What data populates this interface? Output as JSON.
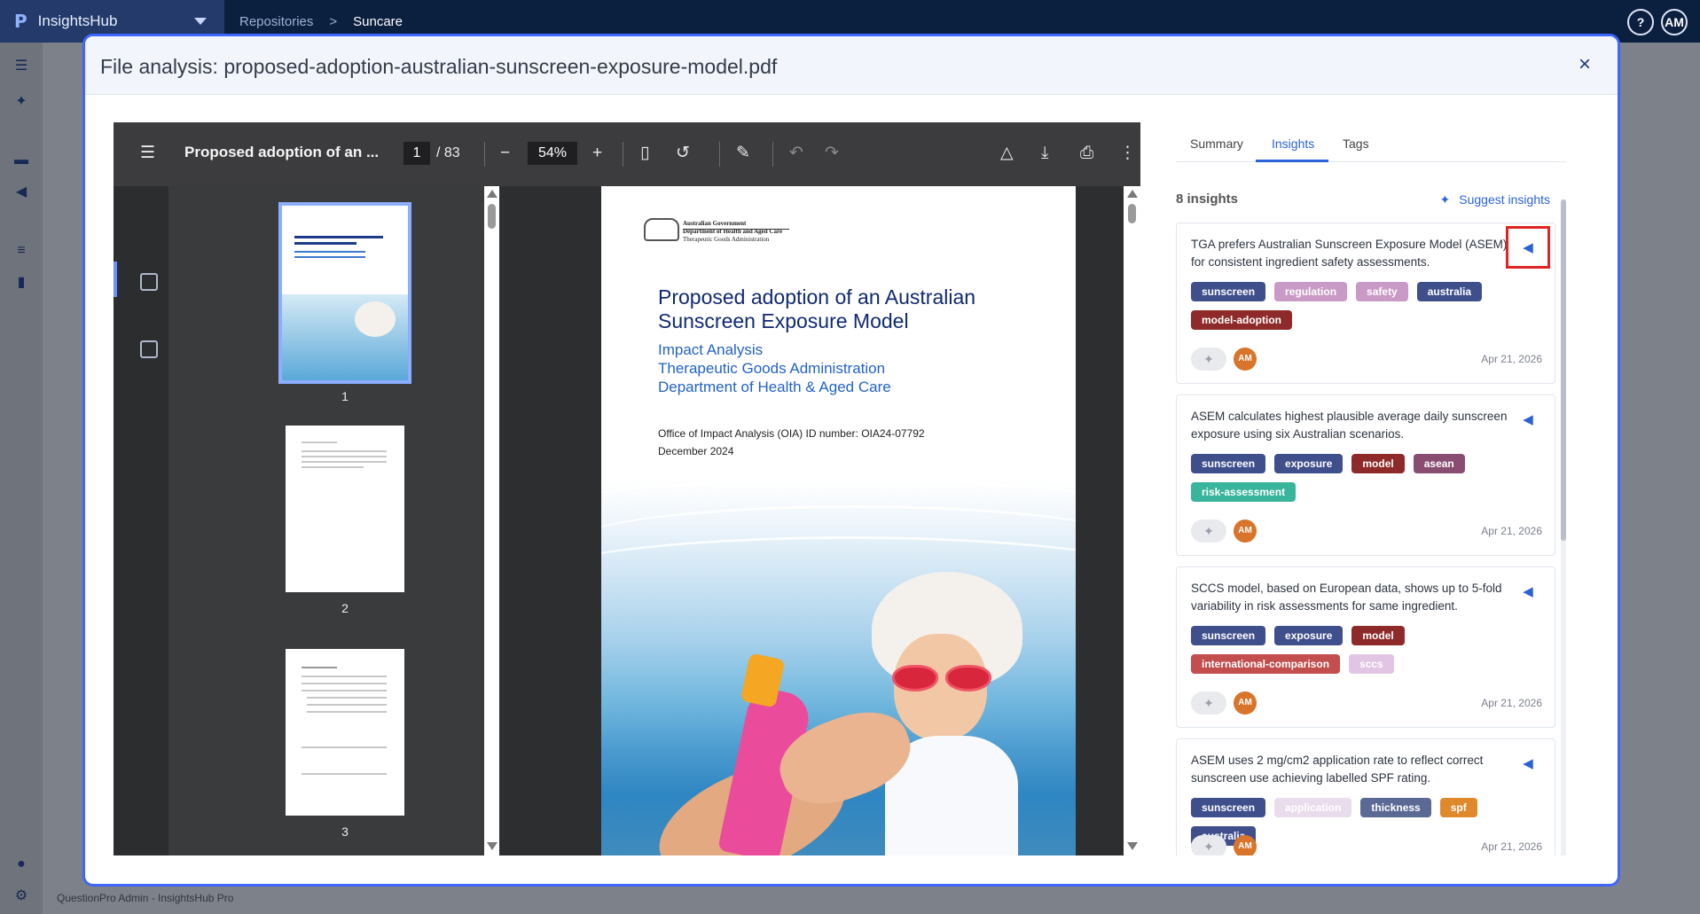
{
  "app": {
    "logo": "P",
    "name": "InsightsHub"
  },
  "breadcrumb": {
    "repositories": "Repositories",
    "separator": ">",
    "current": "Suncare"
  },
  "header_icons": {
    "help": "?",
    "user_initials": "AM"
  },
  "footer": {
    "text": "QuestionPro Admin - InsightsHub Pro"
  },
  "modal": {
    "title": "File analysis: proposed-adoption-australian-sunscreen-exposure-model.pdf",
    "close": "×"
  },
  "pdf": {
    "toolbar_title": "Proposed adoption of an ...",
    "page_current": "1",
    "page_total": "/ 83",
    "zoom": "54%",
    "thumbnails": [
      {
        "label": "1"
      },
      {
        "label": "2"
      },
      {
        "label": "3"
      }
    ],
    "document": {
      "gov_line1": "Australian Government",
      "gov_line2": "Department of Health and Aged Care",
      "gov_line3": "Therapeutic Goods Administration",
      "title": "Proposed adoption of an Australian Sunscreen Exposure Model",
      "subtitle_1": "Impact Analysis",
      "subtitle_2": "Therapeutic Goods Administration",
      "subtitle_3": "Department of Health & Aged Care",
      "oia": "Office of Impact Analysis (OIA) ID number: OIA24-07792",
      "date": "December 2024"
    }
  },
  "tabs": [
    {
      "label": "Summary"
    },
    {
      "label": "Insights"
    },
    {
      "label": "Tags"
    }
  ],
  "insights": {
    "count": "8 insights",
    "suggest_label": "Suggest insights",
    "cards": [
      {
        "text": "TGA prefers Australian Sunscreen Exposure Model (ASEM) for consistent ingredient safety assessments.",
        "tags": [
          {
            "label": "sunscreen",
            "color": "#3f4f8c"
          },
          {
            "label": "regulation",
            "color": "#c99ac6"
          },
          {
            "label": "safety",
            "color": "#c99ac6"
          },
          {
            "label": "australia",
            "color": "#3f4f8c"
          },
          {
            "label": "model-adoption",
            "color": "#8e2a2a"
          }
        ],
        "avatar": "AM",
        "date": "Apr 21, 2026"
      },
      {
        "text": "ASEM calculates highest plausible average daily sunscreen exposure using six Australian scenarios.",
        "tags": [
          {
            "label": "sunscreen",
            "color": "#3f4f8c"
          },
          {
            "label": "exposure",
            "color": "#3f4f8c"
          },
          {
            "label": "model",
            "color": "#8e2a2a"
          },
          {
            "label": "asean",
            "color": "#8a4d72"
          },
          {
            "label": "risk-assessment",
            "color": "#38b59b"
          }
        ],
        "avatar": "AM",
        "date": "Apr 21, 2026"
      },
      {
        "text": "SCCS model, based on European data, shows up to 5-fold variability in risk assessments for same ingredient.",
        "tags": [
          {
            "label": "sunscreen",
            "color": "#3f4f8c"
          },
          {
            "label": "exposure",
            "color": "#3f4f8c"
          },
          {
            "label": "model",
            "color": "#8e2a2a"
          },
          {
            "label": "international-comparison",
            "color": "#c24e4e"
          },
          {
            "label": "sccs",
            "color": "#e2c4e4"
          }
        ],
        "avatar": "AM",
        "date": "Apr 21, 2026"
      },
      {
        "text": "ASEM uses 2 mg/cm2 application rate to reflect correct sunscreen use achieving labelled SPF rating.",
        "tags": [
          {
            "label": "sunscreen",
            "color": "#3f4f8c"
          },
          {
            "label": "application",
            "color": "#e9dcec"
          },
          {
            "label": "thickness",
            "color": "#5a6a94"
          },
          {
            "label": "spf",
            "color": "#e0892c"
          },
          {
            "label": "australia",
            "color": "#3f4f8c"
          }
        ],
        "avatar": "AM",
        "date": "Apr 21, 2026"
      }
    ]
  }
}
